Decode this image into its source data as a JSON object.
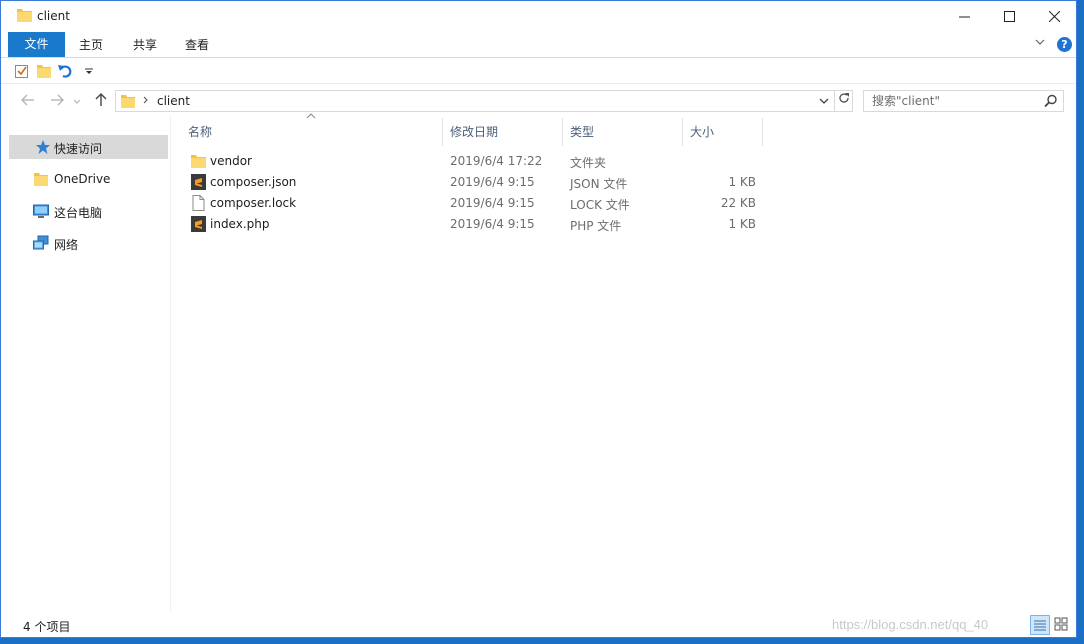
{
  "window": {
    "title": "client"
  },
  "ribbon": {
    "tabs": [
      {
        "label": "文件"
      },
      {
        "label": "主页"
      },
      {
        "label": "共享"
      },
      {
        "label": "查看"
      }
    ],
    "help_label": "?"
  },
  "navigation": {
    "address_path": "client",
    "search_placeholder": "搜索\"client\""
  },
  "sidebar": {
    "items": [
      {
        "label": "快速访问",
        "icon": "star-icon",
        "active": true
      },
      {
        "label": "OneDrive",
        "icon": "folder-icon",
        "active": false
      },
      {
        "label": "这台电脑",
        "icon": "computer-icon",
        "active": false
      },
      {
        "label": "网络",
        "icon": "network-icon",
        "active": false
      }
    ]
  },
  "columns": {
    "name": "名称",
    "date": "修改日期",
    "type": "类型",
    "size": "大小"
  },
  "files": [
    {
      "name": "vendor",
      "date": "2019/6/4 17:22",
      "type": "文件夹",
      "size": "",
      "icon": "folder-icon"
    },
    {
      "name": "composer.json",
      "date": "2019/6/4 9:15",
      "type": "JSON 文件",
      "size": "1 KB",
      "icon": "sublime-file-icon"
    },
    {
      "name": "composer.lock",
      "date": "2019/6/4 9:15",
      "type": "LOCK 文件",
      "size": "22 KB",
      "icon": "blank-file-icon"
    },
    {
      "name": "index.php",
      "date": "2019/6/4 9:15",
      "type": "PHP 文件",
      "size": "1 KB",
      "icon": "sublime-file-icon"
    }
  ],
  "status": {
    "item_count": "4 个项目"
  },
  "watermark": "https://blog.csdn.net/qq_40"
}
